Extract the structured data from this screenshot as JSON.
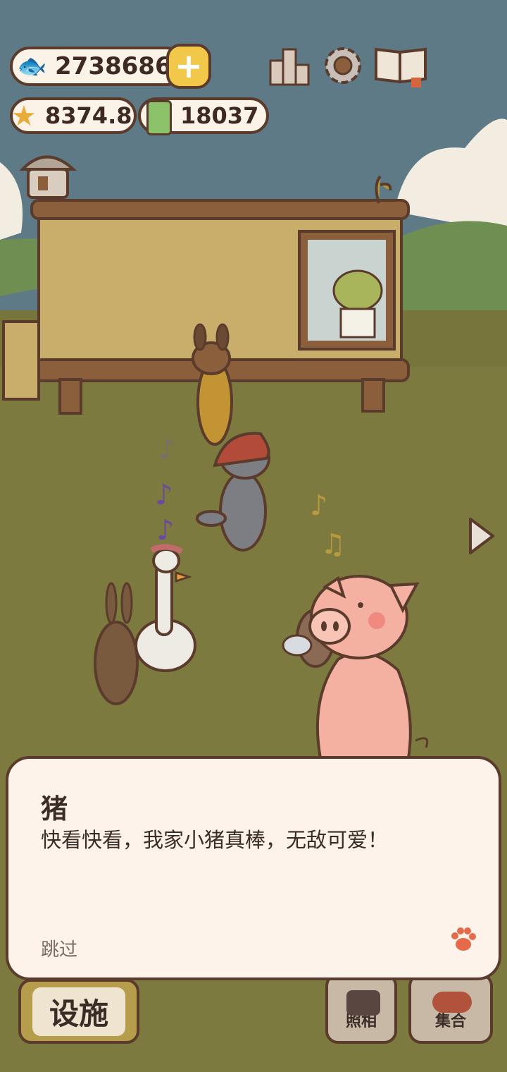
{
  "hud": {
    "fish_value": "2738686",
    "star_value": "8374.8",
    "battery_value": "18037"
  },
  "dialog": {
    "speaker": "猪",
    "text": "快看快看，我家小猪真棒，无敌可爱！",
    "skip_label": "跳过"
  },
  "bottom_bar": {
    "facilities_label": "设施",
    "photo_label": "照相",
    "gather_label": "集合"
  },
  "colors": {
    "sky": "#5d7a86",
    "ground": "#7d7a3f",
    "pig": "#f4b0a0",
    "outline": "#5a3b2c",
    "plus_button": "#f2c84b"
  }
}
